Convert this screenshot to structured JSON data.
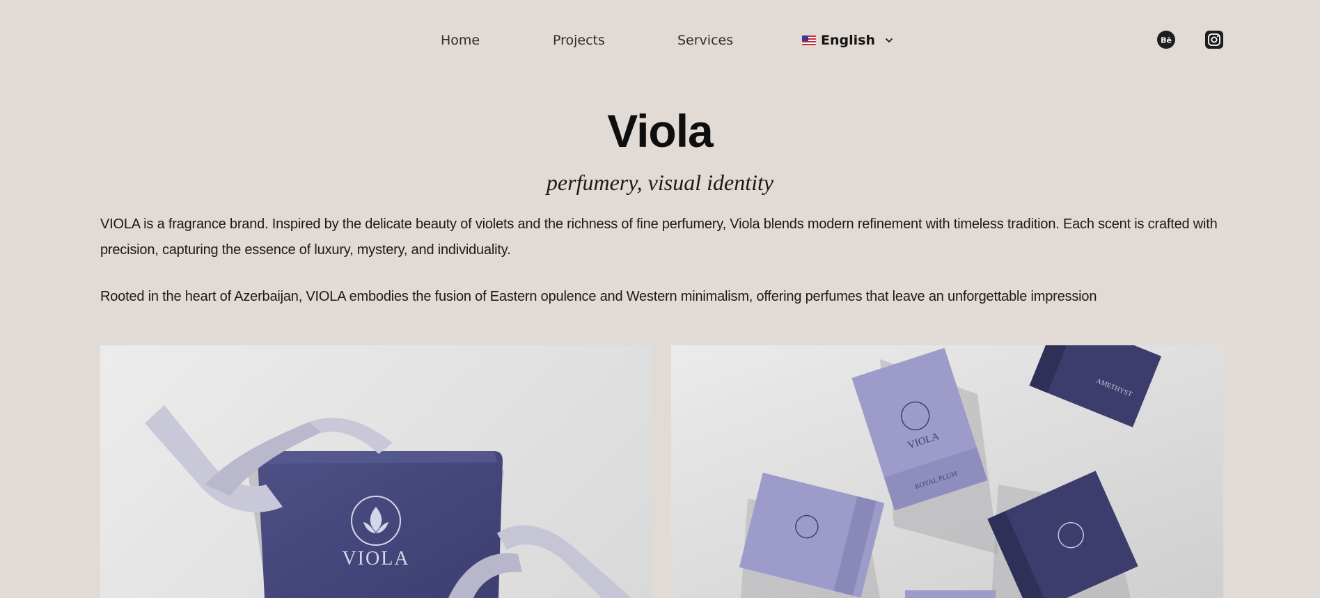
{
  "nav": {
    "home": "Home",
    "projects": "Projects",
    "services": "Services",
    "language": "English"
  },
  "social": {
    "behance_glyph": "Bē",
    "behance_icon": "behance-icon",
    "instagram_icon": "instagram-icon"
  },
  "header": {
    "title": "Viola",
    "subtitle": "perfumery, visual identity"
  },
  "description": {
    "paragraph_1": "VIOLA is a fragrance brand. Inspired by the delicate beauty of violets and the richness of fine perfumery, Viola blends modern refinement with timeless tradition. Each scent is crafted with precision, capturing the essence of luxury, mystery, and individuality.",
    "paragraph_2": "Rooted in the heart of Azerbaijan, VIOLA embodies the fusion of Eastern opulence and Western minimalism, offering perfumes that leave an unforgettable impression"
  },
  "gallery": {
    "image_1_brand": "VIOLA",
    "image_2_brand": "VIOLA",
    "image_2_label_a": "ROYAL PLUM",
    "image_2_label_b": "AMETHYST"
  },
  "colors": {
    "background": "#e1dad5",
    "brand_dark": "#45467a",
    "brand_light": "#9795c4"
  }
}
